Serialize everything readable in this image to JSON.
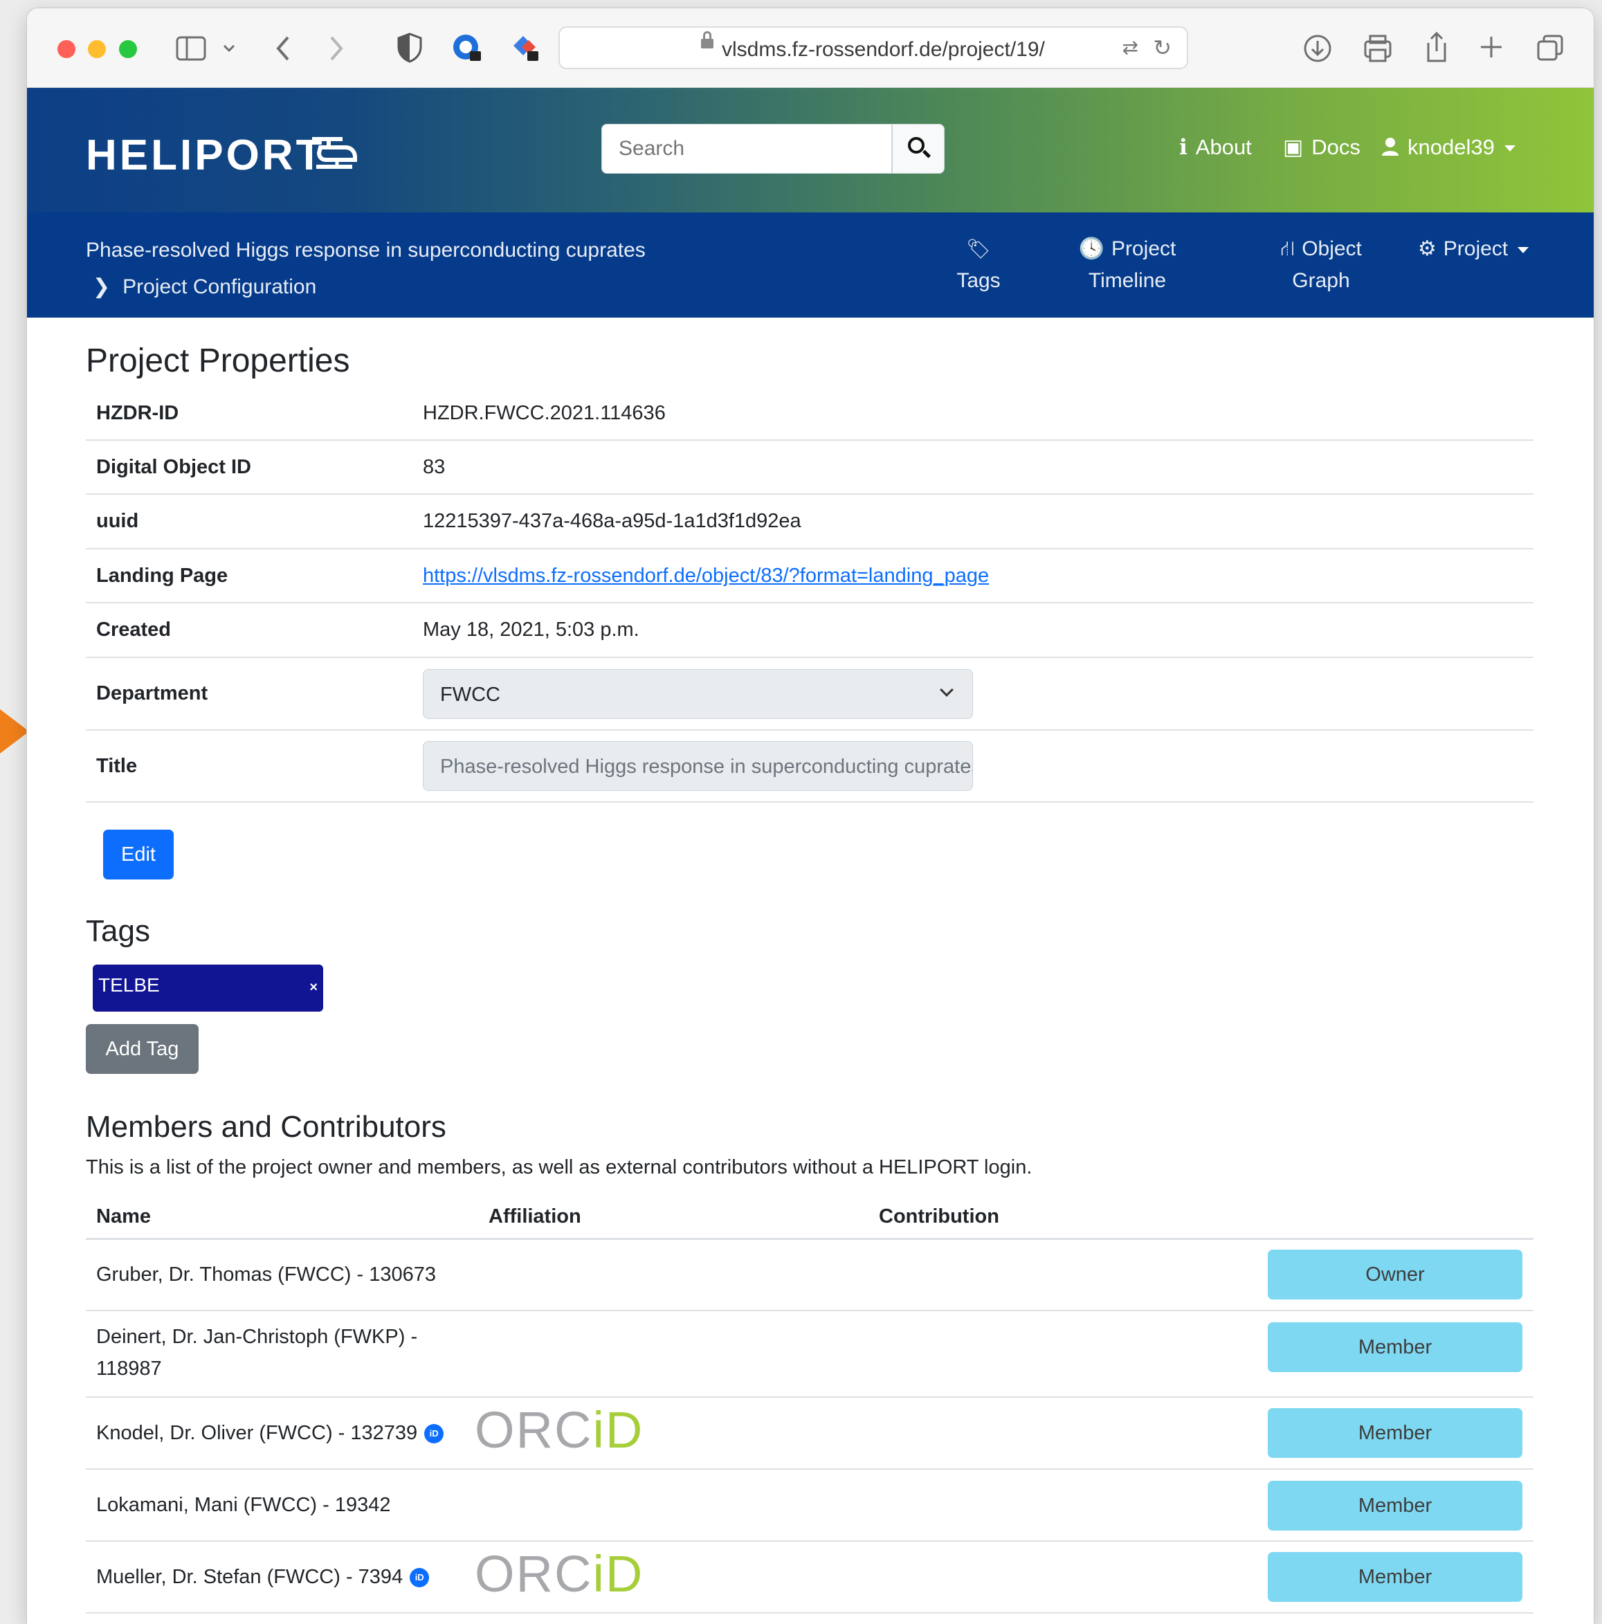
{
  "browser": {
    "url": "vlsdms.fz-rossendorf.de/project/19/"
  },
  "header": {
    "logo_text": "HELIPORT",
    "search_placeholder": "Search",
    "about_label": "About",
    "docs_label": "Docs",
    "user_label": "knodel39"
  },
  "project_nav": {
    "project_title": "Phase-resolved Higgs response in superconducting cuprates",
    "breadcrumb": "Project Configuration",
    "items": [
      {
        "line1": "",
        "line2": "Tags"
      },
      {
        "line1": "Project",
        "line2": "Timeline"
      },
      {
        "line1": "Object",
        "line2": "Graph"
      },
      {
        "line1": "Project",
        "line2": ""
      }
    ]
  },
  "properties": {
    "title": "Project Properties",
    "rows": [
      {
        "key": "HZDR-ID",
        "value": "HZDR.FWCC.2021.114636"
      },
      {
        "key": "Digital Object ID",
        "value": "83"
      },
      {
        "key": "uuid",
        "value": "12215397-437a-468a-a95d-1a1d3f1d92ea"
      },
      {
        "key": "Landing Page",
        "value": "https://vlsdms.fz-rossendorf.de/object/83/?format=landing_page"
      },
      {
        "key": "Created",
        "value": "May 18, 2021, 5:03 p.m."
      }
    ],
    "department": {
      "key": "Department",
      "value": "FWCC"
    },
    "title_field": {
      "key": "Title",
      "value": "Phase-resolved Higgs response in superconducting cuprates"
    },
    "edit_label": "Edit"
  },
  "tags": {
    "title": "Tags",
    "items": [
      {
        "label": "TELBE",
        "color": "#121593"
      }
    ],
    "remove_glyph": "×",
    "add_label": "Add Tag"
  },
  "members": {
    "title": "Members and Contributors",
    "description": "This is a list of the project owner and members, as well as external contributors without a HELIPORT login.",
    "columns": [
      "Name",
      "Affiliation",
      "Contribution"
    ],
    "rows": [
      {
        "name": "Gruber, Dr. Thomas (FWCC) - 130673",
        "orcid": false,
        "role": "Owner"
      },
      {
        "name": "Deinert, Dr. Jan-Christoph (FWKP) - 118987",
        "orcid": false,
        "role": "Member"
      },
      {
        "name": "Knodel, Dr. Oliver (FWCC) - 132739",
        "orcid": true,
        "role": "Member"
      },
      {
        "name": "Lokamani, Mani (FWCC) - 19342",
        "orcid": false,
        "role": "Member"
      },
      {
        "name": "Mueller, Dr. Stefan (FWCC) - 7394",
        "orcid": true,
        "role": "Member"
      }
    ],
    "orcid_badge": "iD",
    "orcid_logo_prefix": "ORC",
    "orcid_logo_suffix": "iD"
  },
  "colors": {
    "primary": "#0d6efd",
    "nav_blue": "#053b8a",
    "role_button": "#7fd8f2",
    "tag": "#121593",
    "secondary": "#6c757d"
  }
}
